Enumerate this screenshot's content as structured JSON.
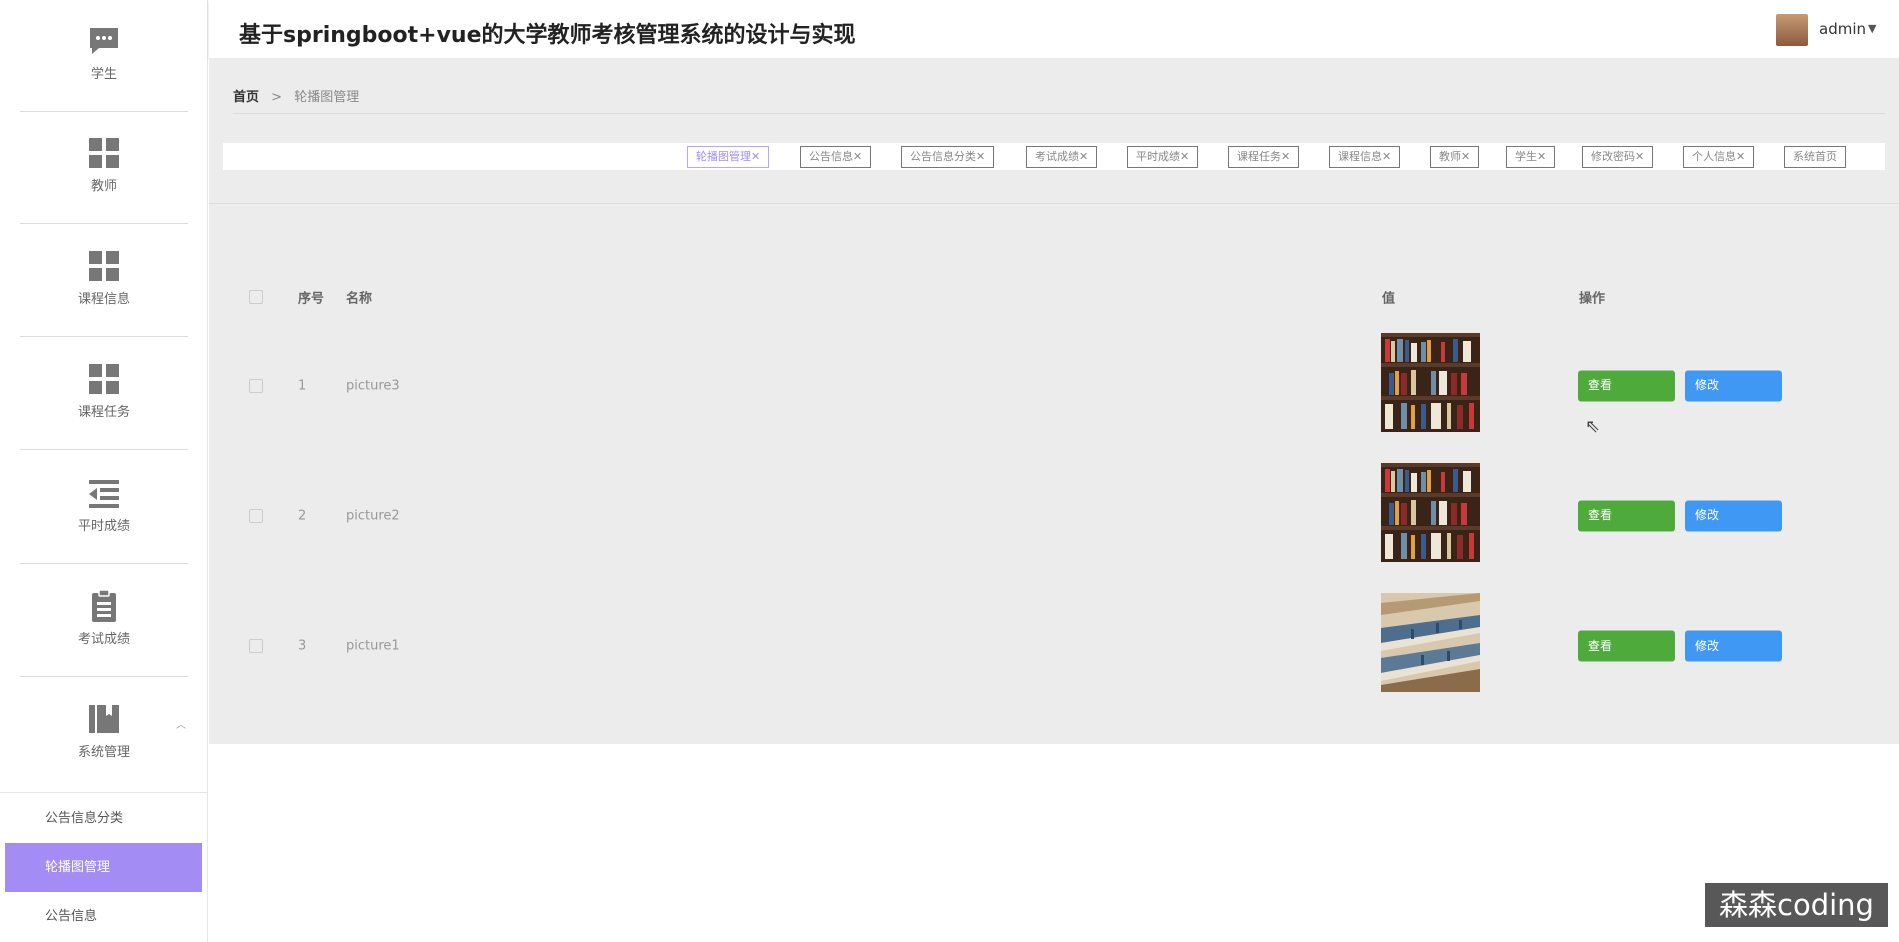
{
  "header": {
    "title": "基于springboot+vue的大学教师考核管理系统的设计与实现",
    "username": "admin"
  },
  "sidebar": {
    "items": [
      {
        "label": "学生",
        "icon": "chat-icon"
      },
      {
        "label": "教师",
        "icon": "grid-icon"
      },
      {
        "label": "课程信息",
        "icon": "grid-icon"
      },
      {
        "label": "课程任务",
        "icon": "grid-icon"
      },
      {
        "label": "平时成绩",
        "icon": "list-indent-icon"
      },
      {
        "label": "考试成绩",
        "icon": "clipboard-icon"
      },
      {
        "label": "系统管理",
        "icon": "book-icon"
      }
    ],
    "subitems": [
      {
        "label": "公告信息分类"
      },
      {
        "label": "轮播图管理"
      },
      {
        "label": "公告信息"
      }
    ]
  },
  "breadcrumb": {
    "home": "首页",
    "separator": ">",
    "current": "轮播图管理"
  },
  "tags": [
    {
      "label": "轮播图管理"
    },
    {
      "label": "公告信息"
    },
    {
      "label": "公告信息分类"
    },
    {
      "label": "考试成绩"
    },
    {
      "label": "平时成绩"
    },
    {
      "label": "课程任务"
    },
    {
      "label": "课程信息"
    },
    {
      "label": "教师"
    },
    {
      "label": "学生"
    },
    {
      "label": "修改密码"
    },
    {
      "label": "个人信息"
    },
    {
      "label": "系统首页"
    }
  ],
  "table": {
    "columns": [
      "序号",
      "名称",
      "值",
      "操作"
    ],
    "rows": [
      {
        "index": "1",
        "name": "picture3",
        "image": "bookshelf"
      },
      {
        "index": "2",
        "name": "picture2",
        "image": "bookshelf"
      },
      {
        "index": "3",
        "name": "picture1",
        "image": "library-shelves"
      }
    ],
    "view_label": "查看",
    "edit_label": "修改"
  },
  "watermark": "森森coding",
  "colors": {
    "accent": "#a38cf4",
    "view_button": "#4eaa3b",
    "edit_button": "#4098f5",
    "background": "#ececec"
  }
}
